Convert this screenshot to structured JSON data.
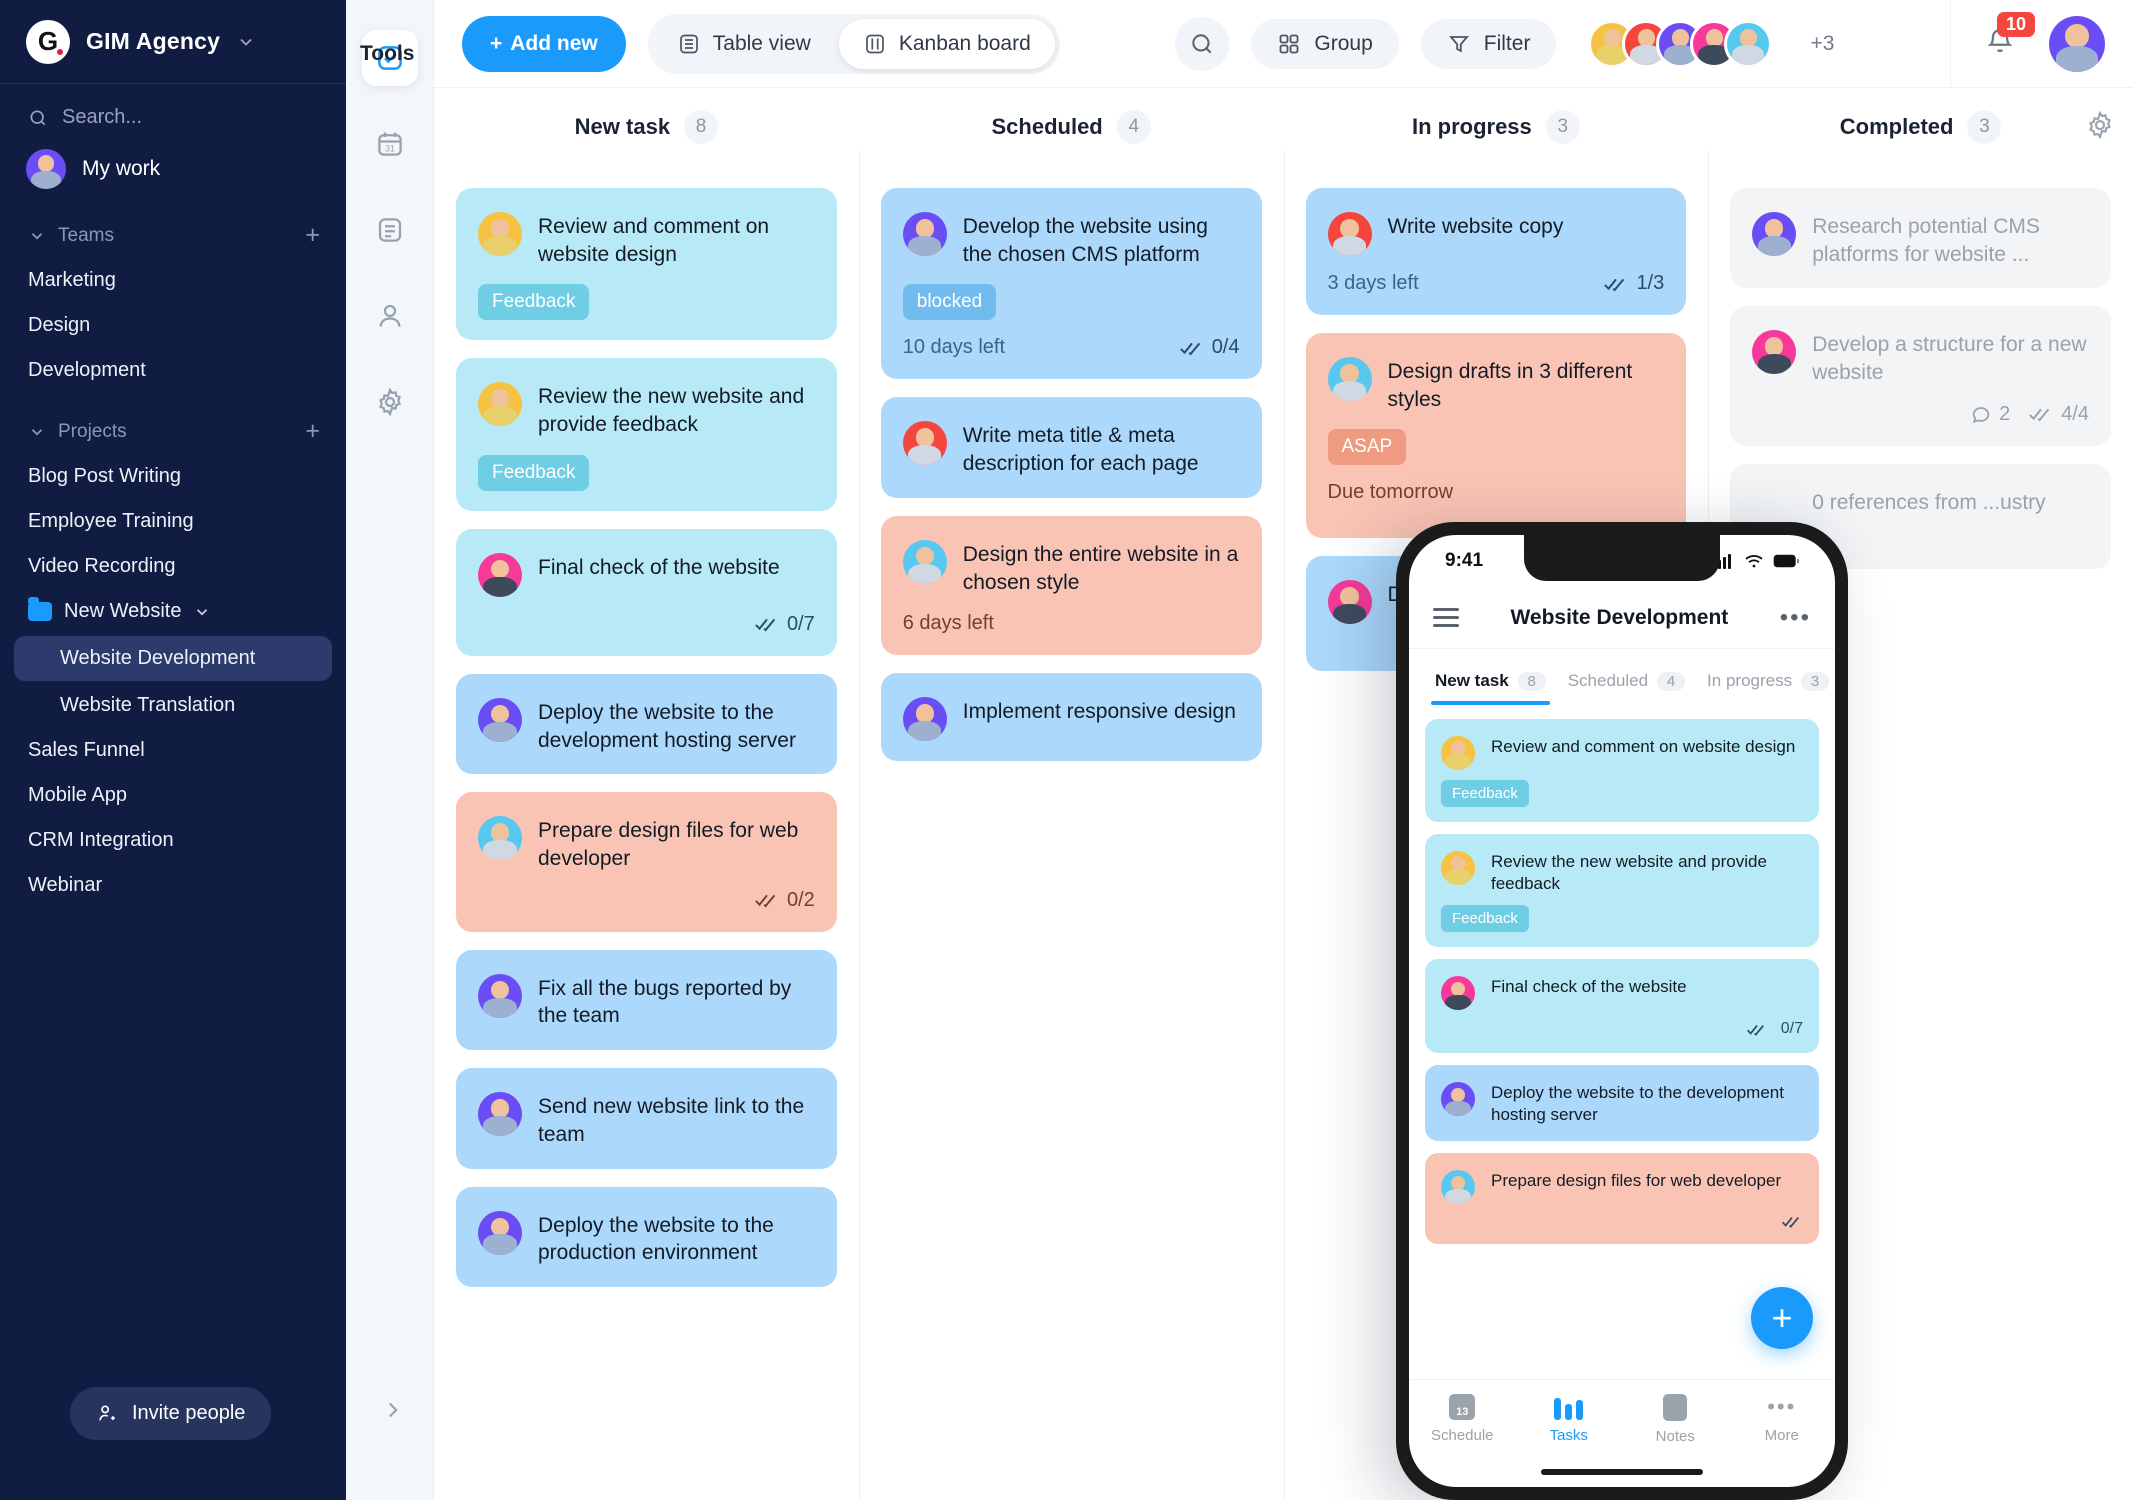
{
  "sidebar": {
    "brand": {
      "logo_letter": "G",
      "name": "GIM Agency",
      "chevron": "chevron-down"
    },
    "search_placeholder": "Search...",
    "my_work": "My work",
    "teams_label": "Teams",
    "teams": [
      "Marketing",
      "Design",
      "Development"
    ],
    "projects_label": "Projects",
    "projects": [
      "Blog Post Writing",
      "Employee Training",
      "Video Recording"
    ],
    "folder": {
      "name": "New Website",
      "children": [
        "Website Development",
        "Website Translation"
      ],
      "active": "Website Development"
    },
    "projects_after": [
      "Sales Funnel",
      "Mobile App",
      "CRM Integration",
      "Webinar"
    ],
    "invite_label": "Invite people"
  },
  "rail": {
    "title": "Tools",
    "items": [
      {
        "name": "tasks-icon",
        "active": true
      },
      {
        "name": "calendar-icon",
        "label": "31",
        "active": false
      },
      {
        "name": "notes-icon",
        "active": false
      },
      {
        "name": "contacts-icon",
        "active": false
      },
      {
        "name": "settings-icon",
        "active": false
      }
    ]
  },
  "topbar": {
    "add_new": "Add new",
    "views": [
      {
        "label": "Table view",
        "active": false
      },
      {
        "label": "Kanban board",
        "active": true
      }
    ],
    "group_label": "Group",
    "filter_label": "Filter",
    "extra_members": "+3",
    "notification_count": "10"
  },
  "board": {
    "columns": [
      {
        "title": "New task",
        "count": "8",
        "cards": [
          {
            "title": "Review and comment on website design",
            "color": "cyan",
            "avatar": "#f5c242",
            "tag": "Feedback",
            "tag_type": "feedback"
          },
          {
            "title": "Review the new website and provide feedback",
            "color": "cyan",
            "avatar": "#f5c242",
            "tag": "Feedback",
            "tag_type": "feedback"
          },
          {
            "title": "Final check of the website",
            "color": "cyan",
            "avatar": "#f6399a",
            "checklist": "0/7"
          },
          {
            "title": "Deploy the website to the development hosting server",
            "color": "blue",
            "avatar": "#6b4df6"
          },
          {
            "title": "Prepare design files for web developer",
            "color": "peach",
            "avatar": "#57c8ef",
            "checklist": "0/2"
          },
          {
            "title": "Fix all the bugs reported by the team",
            "color": "blue",
            "avatar": "#6b4df6"
          },
          {
            "title": "Send new website link to the team",
            "color": "blue",
            "avatar": "#6b4df6"
          },
          {
            "title": "Deploy the website to the production environment",
            "color": "blue",
            "avatar": "#6b4df6"
          }
        ]
      },
      {
        "title": "Scheduled",
        "count": "4",
        "cards": [
          {
            "title": "Develop the website using the chosen CMS platform",
            "color": "blue",
            "avatar": "#6b4df6",
            "tag": "blocked",
            "tag_type": "blocked",
            "due": "10 days left",
            "checklist": "0/4"
          },
          {
            "title": "Write meta title & meta description for each page",
            "color": "blue",
            "avatar": "#f4453e"
          },
          {
            "title": "Design the entire website in a chosen style",
            "color": "peach",
            "avatar": "#57c8ef",
            "due": "6 days left"
          },
          {
            "title": "Implement responsive design",
            "color": "blue",
            "avatar": "#6b4df6"
          }
        ]
      },
      {
        "title": "In progress",
        "count": "3",
        "cards": [
          {
            "title": "Write website copy",
            "color": "blue",
            "avatar": "#f4453e",
            "due": "3 days left",
            "checklist": "1/3"
          },
          {
            "title": "Design drafts in 3 different styles",
            "color": "peach",
            "avatar": "#57c8ef",
            "tag": "ASAP",
            "tag_type": "asap",
            "due": "Due tomorrow"
          },
          {
            "title": "De",
            "color": "blue",
            "avatar": "#f6399a"
          }
        ]
      },
      {
        "title": "Completed",
        "count": "3",
        "cards": [
          {
            "title": "Research potential CMS platforms for website ...",
            "color": "done",
            "avatar": "#6b4df6"
          },
          {
            "title": "Develop a structure for a new website",
            "color": "done",
            "avatar": "#f6399a",
            "comments": "2",
            "checklist": "4/4"
          },
          {
            "title": "0 references from ...ustry",
            "color": "done",
            "avatar": "#6b4df6"
          }
        ]
      }
    ]
  },
  "phone": {
    "status_time": "9:41",
    "header_title": "Website Development",
    "tabs": [
      {
        "label": "New task",
        "count": "8",
        "active": true
      },
      {
        "label": "Scheduled",
        "count": "4",
        "active": false
      },
      {
        "label": "In progress",
        "count": "3",
        "active": false
      }
    ],
    "cards": [
      {
        "title": "Review and comment on website design",
        "color": "cyan",
        "avatar": "#f5c242",
        "tag": "Feedback"
      },
      {
        "title": "Review the new website and provide feedback",
        "color": "cyan",
        "avatar": "#f5c242",
        "tag": "Feedback"
      },
      {
        "title": "Final check of the website",
        "color": "cyan",
        "avatar": "#f6399a",
        "checklist": "0/7"
      },
      {
        "title": "Deploy the website to the development hosting server",
        "color": "blue",
        "avatar": "#6b4df6"
      },
      {
        "title": "Prepare design files for web developer",
        "color": "peach",
        "avatar": "#57c8ef",
        "checklist": ""
      }
    ],
    "fab": "+",
    "tabbar": [
      {
        "label": "Schedule",
        "icon": "calendar-icon",
        "badge": "13",
        "active": false
      },
      {
        "label": "Tasks",
        "icon": "tasks-bars-icon",
        "active": true
      },
      {
        "label": "Notes",
        "icon": "notes-icon",
        "active": false
      },
      {
        "label": "More",
        "icon": "more-icon",
        "active": false
      }
    ]
  },
  "colors": {
    "accent": "#1a9bfc",
    "sidebar_bg": "#101c42",
    "badge_red": "#f4453e"
  }
}
